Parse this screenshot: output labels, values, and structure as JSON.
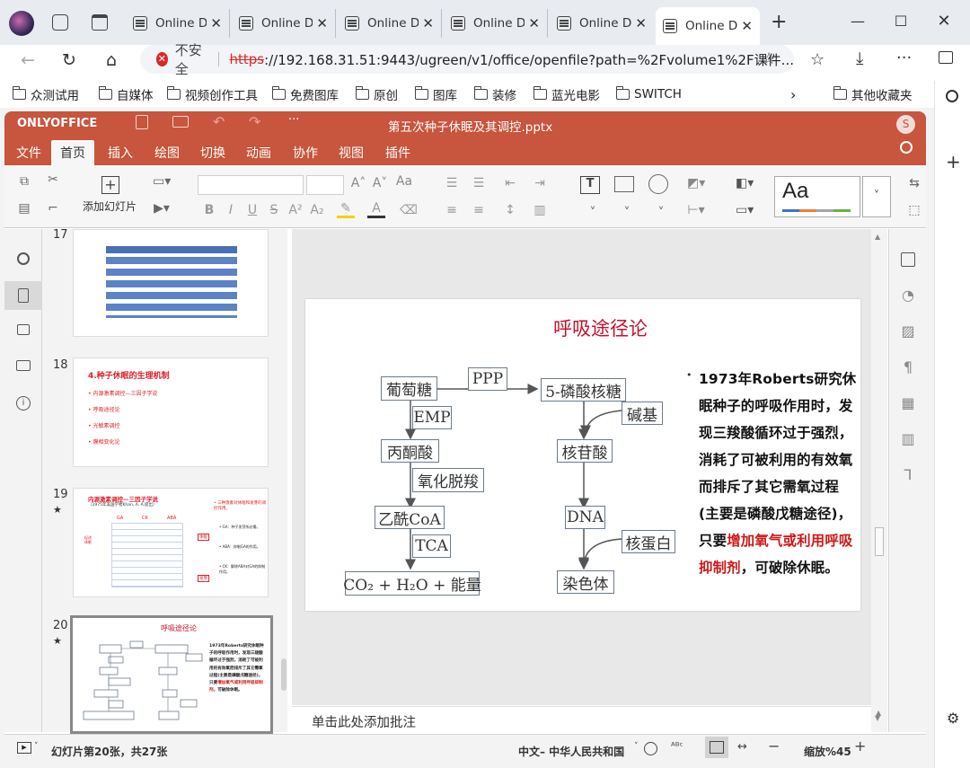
{
  "browser": {
    "tabs": [
      {
        "title": "Online Do"
      },
      {
        "title": "Online Do"
      },
      {
        "title": "Online Do"
      },
      {
        "title": "Online Do"
      },
      {
        "title": "Online Do"
      },
      {
        "title": "Online Do"
      }
    ],
    "new_tab": "+",
    "address": {
      "warning_label": "不安全",
      "protocol": "https",
      "url_rest": "://192.168.31.51:9443/ugreen/v1/office/openfile?path=%2Fvolume1%2F课件..."
    },
    "bookmarks": [
      "众测试用",
      "自媒体",
      "视频创作工具",
      "免费图库",
      "原创",
      "图库",
      "装修",
      "蓝光电影",
      "SWITCH"
    ],
    "other_bookmarks": "其他收藏夹"
  },
  "editor": {
    "brand": "ONLYOFFICE",
    "doc_title": "第五次种子休眠及其调控.pptx",
    "user_initial": "S",
    "menu": [
      "文件",
      "首页",
      "插入",
      "绘图",
      "切换",
      "动画",
      "协作",
      "视图",
      "插件"
    ],
    "active_menu": "首页",
    "toolbar": {
      "add_slide": "添加幻灯片",
      "style_preview": "Aa"
    },
    "thumbnails": [
      {
        "number": "17"
      },
      {
        "number": "18",
        "title": "4.种子休眠的生理机制",
        "items": [
          "• 内源激素调控—三因子学说",
          "• 呼吸途径论",
          "• 光敏素调控",
          "• 膜相变化论"
        ]
      },
      {
        "number": "19",
        "title": "内源激素调控—三因子学说",
        "subtitle": "（1975年美国学者Khan, A. A.提出）",
        "cols": [
          "GA",
          "CK",
          "ABA"
        ],
        "side_label": "促进休眠",
        "right_title": "• 三种激素对休眠和发芽的调控作用。",
        "right_items": [
          "• GA：种子发芽所必需。",
          "• ABA：抑制GA的作用。",
          "• CK：解除ABA对GA的抑制作用。"
        ],
        "tag1": "休眠",
        "tag2": "发芽"
      },
      {
        "number": "20",
        "title": "呼吸途径论"
      }
    ],
    "notes_placeholder": "单击此处添加批注",
    "status": {
      "slide_info": "幻灯片第20张，共27张",
      "language": "中文– 中华人民共和国",
      "zoom": "缩放%45"
    }
  },
  "slide": {
    "title": "呼吸途径论",
    "nodes": {
      "glucose": "葡萄糖",
      "ppp": "PPP",
      "ribose": "5-磷酸核糖",
      "base": "碱基",
      "emp": "EMP",
      "pyruvate": "丙酮酸",
      "nucleotide": "核苷酸",
      "decarbox": "氧化脱羧",
      "acetylcoa": "乙酰CoA",
      "dna": "DNA",
      "tca": "TCA",
      "histone": "核蛋白",
      "products": "CO₂ + H₂O + 能量",
      "chromosome": "染色体"
    },
    "bullet_mark": "•",
    "text_before": "1973年Roberts研究休眠种子的呼吸作用时，发现三羧酸循环过于强烈，消耗了可被利用的有效氧而排斥了其它需氧过程(主要是磷酸戊糖途径)，只要",
    "text_highlight": "增加氧气或利用呼吸抑制剂",
    "text_after": "，可破除休眠。",
    "accent_color": "#cc1818"
  }
}
